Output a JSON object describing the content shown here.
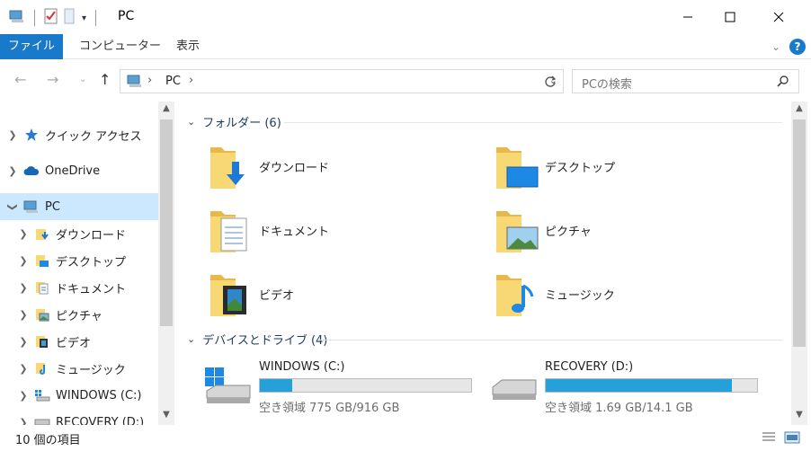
{
  "window": {
    "title": "PC"
  },
  "ribbon": {
    "tabs": [
      "ファイル",
      "コンピューター",
      "表示"
    ]
  },
  "address": {
    "path": "PC",
    "search_placeholder": "PCの検索"
  },
  "nav_pane": {
    "items": [
      {
        "label": "クイック アクセス",
        "icon": "star-icon"
      },
      {
        "label": "OneDrive",
        "icon": "cloud-icon"
      },
      {
        "label": "PC",
        "icon": "computer-icon"
      },
      {
        "label": "ダウンロード",
        "icon": "download-folder-icon"
      },
      {
        "label": "デスクトップ",
        "icon": "desktop-folder-icon"
      },
      {
        "label": "ドキュメント",
        "icon": "documents-folder-icon"
      },
      {
        "label": "ピクチャ",
        "icon": "pictures-folder-icon"
      },
      {
        "label": "ビデオ",
        "icon": "videos-folder-icon"
      },
      {
        "label": "ミュージック",
        "icon": "music-folder-icon"
      },
      {
        "label": "WINDOWS (C:)",
        "icon": "windows-drive-icon"
      },
      {
        "label": "RECOVERY (D:)",
        "icon": "drive-icon"
      }
    ]
  },
  "content": {
    "folders_header": "フォルダー (6)",
    "folders": [
      {
        "label": "ダウンロード",
        "icon": "download-folder-icon"
      },
      {
        "label": "デスクトップ",
        "icon": "desktop-folder-icon"
      },
      {
        "label": "ドキュメント",
        "icon": "documents-folder-icon"
      },
      {
        "label": "ピクチャ",
        "icon": "pictures-folder-icon"
      },
      {
        "label": "ビデオ",
        "icon": "videos-folder-icon"
      },
      {
        "label": "ミュージック",
        "icon": "music-folder-icon"
      }
    ],
    "devices_header": "デバイスとドライブ (4)",
    "drives": [
      {
        "name": "WINDOWS (C:)",
        "free": "空き領域 775 GB/916 GB",
        "used_fraction": 0.154
      },
      {
        "name": "RECOVERY (D:)",
        "free": "空き領域 1.69 GB/14.1 GB",
        "used_fraction": 0.88
      }
    ]
  },
  "status": {
    "text": "10 個の項目"
  },
  "colors": {
    "accent": "#1979ca",
    "selection": "#cce8ff",
    "drive_bar": "#26a0da",
    "folder": "#f8d775"
  }
}
